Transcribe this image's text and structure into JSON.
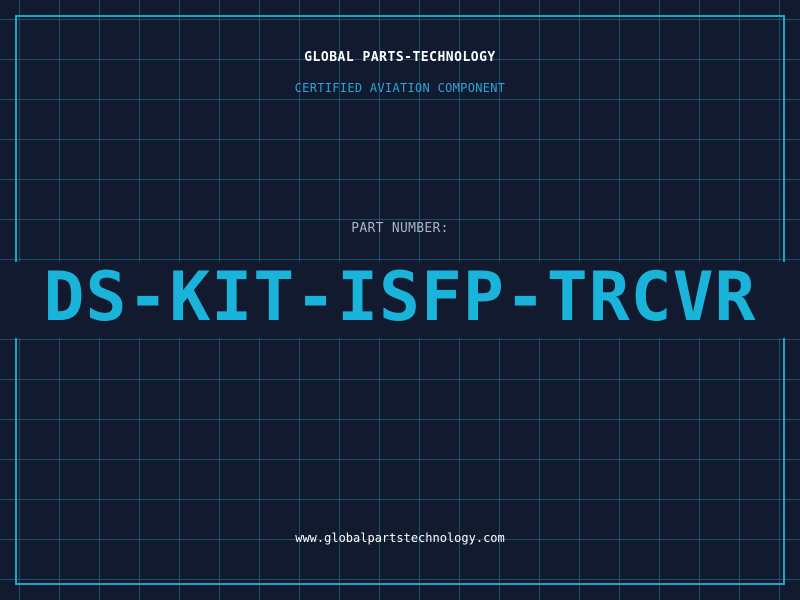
{
  "header": {
    "company_name": "GLOBAL PARTS-TECHNOLOGY",
    "subtitle": "CERTIFIED AVIATION COMPONENT"
  },
  "part": {
    "label": "PART NUMBER:",
    "number": "DS-KIT-ISFP-TRCVR"
  },
  "footer": {
    "website": "www.globalpartstechnology.com"
  },
  "colors": {
    "background": "#111a2e",
    "grid": "#23788f",
    "accent": "#1ab4db",
    "frame": "#1fa3c9",
    "text_primary": "#ffffff",
    "text_muted": "#aab4c8"
  }
}
